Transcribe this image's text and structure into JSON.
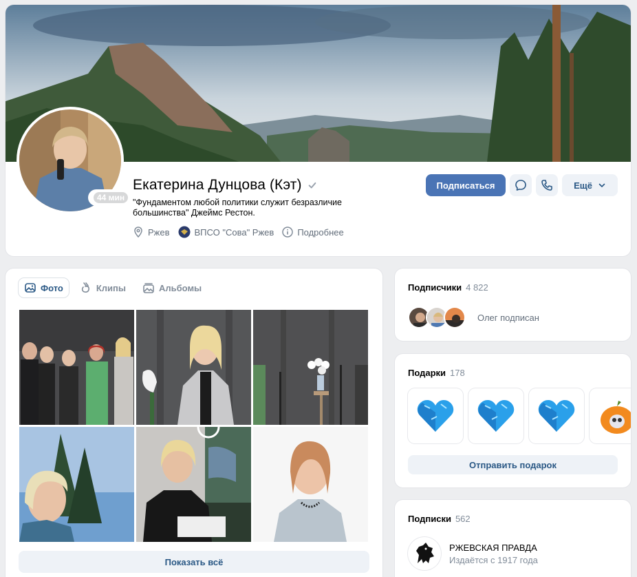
{
  "profile": {
    "name": "Екатерина Дунцова (Кэт)",
    "status": "\"Фундаментом любой политики служит безразличие большинства\" Джеймс Рестон.",
    "online": "44 мин",
    "city": "Ржев",
    "group": "ВПСО \"Сова\" Ржев",
    "details": "Подробнее",
    "subscribe_label": "Подписаться",
    "more_label": "Ещё"
  },
  "photos": {
    "tabs": [
      {
        "label": "Фото",
        "icon": "photo-icon",
        "active": true
      },
      {
        "label": "Клипы",
        "icon": "clips-icon",
        "active": false
      },
      {
        "label": "Альбомы",
        "icon": "albums-icon",
        "active": false
      }
    ],
    "show_all_label": "Показать всё"
  },
  "subscribers": {
    "title": "Подписчики",
    "count": "4 822",
    "friend_note": "Олег подписан"
  },
  "gifts": {
    "title": "Подарки",
    "count": "178",
    "send_label": "Отправить подарок"
  },
  "subscriptions": {
    "title": "Подписки",
    "count": "562",
    "items": [
      {
        "name": "РЖЕВСКАЯ ПРАВДА",
        "desc": "Издаётся с 1917 года"
      }
    ]
  },
  "colors": {
    "accent": "#4a74b5",
    "link": "#2a5885",
    "secondary_bg": "#eef2f7",
    "page_bg": "#edeef0"
  }
}
